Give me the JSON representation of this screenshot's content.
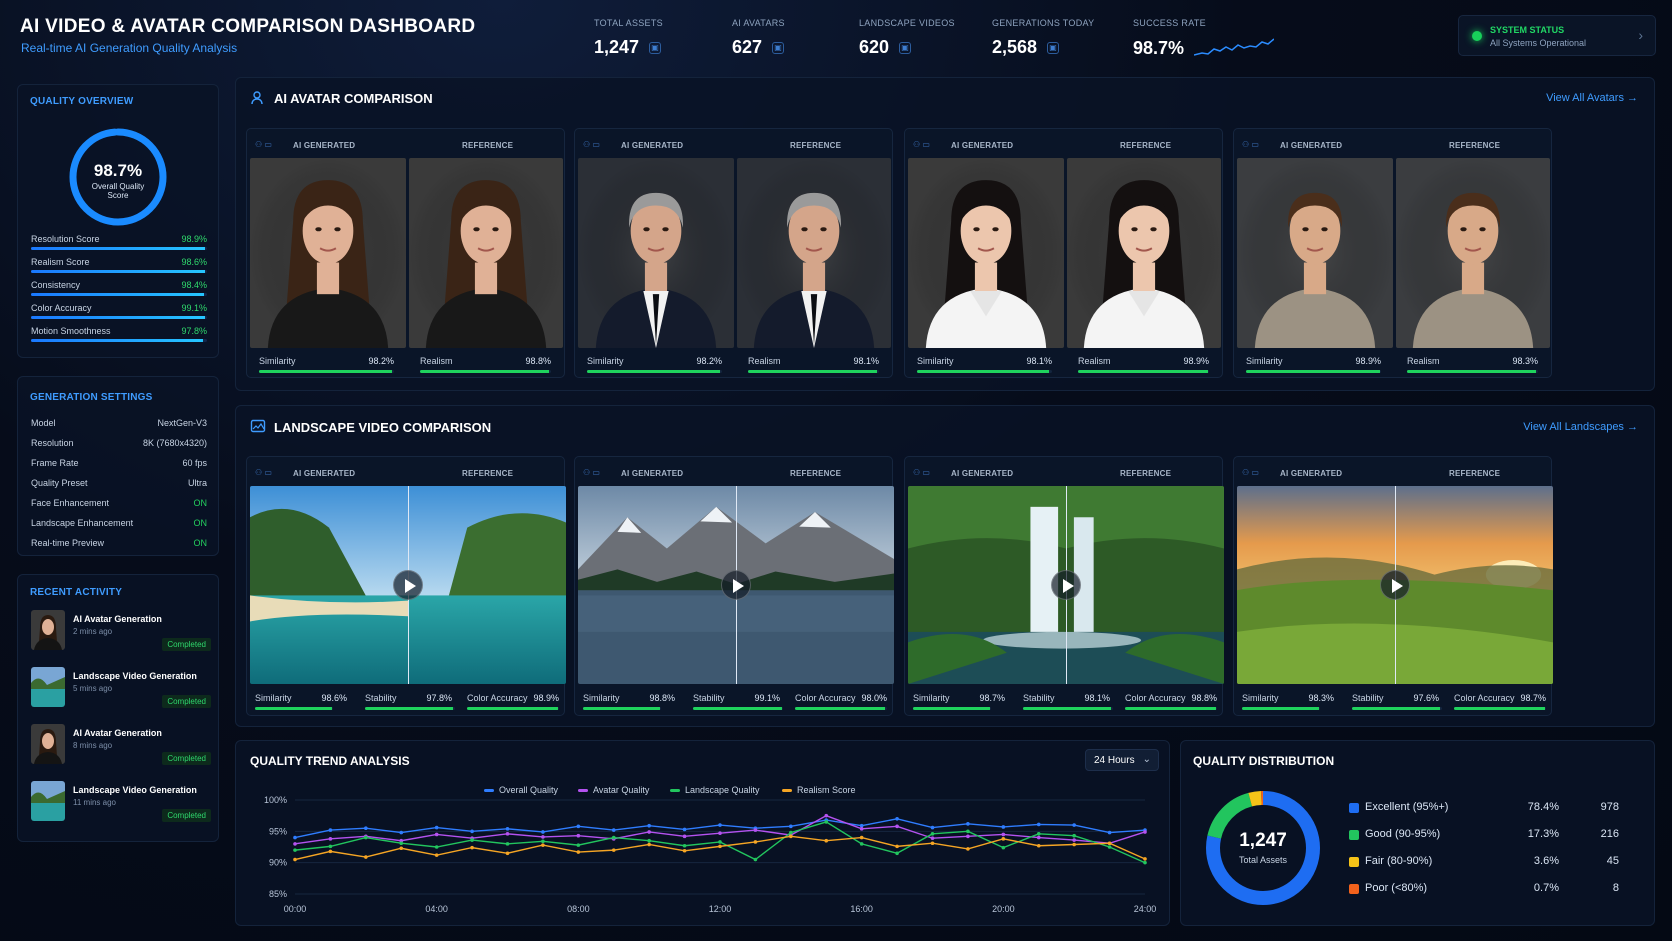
{
  "header": {
    "title": "AI VIDEO & AVATAR COMPARISON DASHBOARD",
    "subtitle": "Real-time AI Generation Quality Analysis"
  },
  "kpis": [
    {
      "label": "TOTAL ASSETS",
      "value": "1,247"
    },
    {
      "label": "AI AVATARS",
      "value": "627"
    },
    {
      "label": "LANDSCAPE VIDEOS",
      "value": "620"
    },
    {
      "label": "GENERATIONS TODAY",
      "value": "2,568"
    },
    {
      "label": "SUCCESS RATE",
      "value": "98.7%"
    }
  ],
  "status": {
    "title": "SYSTEM STATUS",
    "text": "All Systems Operational",
    "color": "#18d05a"
  },
  "quality": {
    "title": "QUALITY OVERVIEW",
    "score": "98.7%",
    "score_label": "Overall Quality Score",
    "score_fraction": 0.987,
    "metrics": [
      {
        "label": "Resolution Score",
        "value": "98.9%",
        "fraction": 0.989
      },
      {
        "label": "Realism Score",
        "value": "98.6%",
        "fraction": 0.986
      },
      {
        "label": "Consistency",
        "value": "98.4%",
        "fraction": 0.984
      },
      {
        "label": "Color Accuracy",
        "value": "99.1%",
        "fraction": 0.991
      },
      {
        "label": "Motion Smoothness",
        "value": "97.8%",
        "fraction": 0.978
      }
    ]
  },
  "settings": {
    "title": "GENERATION SETTINGS",
    "rows": [
      {
        "label": "Model",
        "value": "NextGen-V3"
      },
      {
        "label": "Resolution",
        "value": "8K (7680x4320)"
      },
      {
        "label": "Frame Rate",
        "value": "60 fps"
      },
      {
        "label": "Quality Preset",
        "value": "Ultra"
      },
      {
        "label": "Face Enhancement",
        "value": "ON"
      },
      {
        "label": "Landscape Enhancement",
        "value": "ON"
      },
      {
        "label": "Real-time Preview",
        "value": "ON"
      }
    ]
  },
  "activity": {
    "title": "RECENT ACTIVITY",
    "items": [
      {
        "title": "AI Avatar Generation",
        "time": "2 mins ago",
        "status": "Completed"
      },
      {
        "title": "Landscape Video Generation",
        "time": "5 mins ago",
        "status": "Completed"
      },
      {
        "title": "AI Avatar Generation",
        "time": "8 mins ago",
        "status": "Completed"
      },
      {
        "title": "Landscape Video Generation",
        "time": "11 mins ago",
        "status": "Completed"
      }
    ]
  },
  "avatars": {
    "title": "AI AVATAR COMPARISON",
    "view_all": "View All Avatars",
    "gen_label": "AI GENERATED",
    "ref_label": "REFERENCE",
    "cards": [
      {
        "similarity": "98.2%",
        "realism": "98.8%",
        "sim_f": 0.982,
        "real_f": 0.988
      },
      {
        "similarity": "98.2%",
        "realism": "98.1%",
        "sim_f": 0.982,
        "real_f": 0.981
      },
      {
        "similarity": "98.1%",
        "realism": "98.9%",
        "sim_f": 0.981,
        "real_f": 0.989
      },
      {
        "similarity": "98.9%",
        "realism": "98.3%",
        "sim_f": 0.989,
        "real_f": 0.983
      }
    ],
    "sim_label": "Similarity",
    "real_label": "Realism"
  },
  "landscapes": {
    "title": "LANDSCAPE VIDEO COMPARISON",
    "view_all": "View All Landscapes",
    "gen_label": "AI GENERATED",
    "ref_label": "REFERENCE",
    "sim_label": "Similarity",
    "stab_label": "Stability",
    "col_label": "Color Accuracy",
    "cards": [
      {
        "similarity": "98.6%",
        "stability": "97.8%",
        "color": "98.9%"
      },
      {
        "similarity": "98.8%",
        "stability": "99.1%",
        "color": "98.0%"
      },
      {
        "similarity": "98.7%",
        "stability": "98.1%",
        "color": "98.8%"
      },
      {
        "similarity": "98.3%",
        "stability": "97.6%",
        "color": "98.7%"
      }
    ]
  },
  "trend": {
    "title": "QUALITY TREND ANALYSIS",
    "range": "24 Hours"
  },
  "chart_data": {
    "type": "line",
    "x": [
      "00:00",
      "01:00",
      "02:00",
      "03:00",
      "04:00",
      "05:00",
      "06:00",
      "07:00",
      "08:00",
      "09:00",
      "10:00",
      "11:00",
      "12:00",
      "13:00",
      "14:00",
      "15:00",
      "16:00",
      "17:00",
      "18:00",
      "19:00",
      "20:00",
      "21:00",
      "22:00",
      "23:00",
      "24:00"
    ],
    "xticks": [
      "00:00",
      "04:00",
      "08:00",
      "12:00",
      "16:00",
      "20:00",
      "24:00"
    ],
    "yticks": [
      "100%",
      "95%",
      "90%",
      "85%"
    ],
    "ylim": [
      85,
      100
    ],
    "series": [
      {
        "name": "Overall Quality",
        "color": "#2f7dff",
        "values": [
          94.0,
          95.2,
          95.5,
          94.8,
          95.6,
          95.0,
          95.4,
          94.9,
          95.8,
          95.2,
          95.9,
          95.3,
          96.0,
          95.5,
          95.8,
          96.8,
          95.9,
          97.0,
          95.6,
          96.2,
          95.7,
          96.1,
          96.0,
          94.8,
          95.2
        ]
      },
      {
        "name": "Avatar Quality",
        "color": "#b452f0",
        "values": [
          93.0,
          93.8,
          94.2,
          93.5,
          94.5,
          93.9,
          94.6,
          94.1,
          94.3,
          93.8,
          94.9,
          94.2,
          94.7,
          95.2,
          94.4,
          97.5,
          95.4,
          95.8,
          93.9,
          94.2,
          94.5,
          94.0,
          93.6,
          93.1,
          94.9
        ]
      },
      {
        "name": "Landscape Quality",
        "color": "#22c55e",
        "values": [
          92.0,
          92.6,
          94.0,
          93.1,
          92.5,
          93.6,
          93.0,
          93.4,
          92.8,
          94.0,
          93.5,
          92.7,
          93.3,
          90.5,
          94.8,
          96.5,
          93.0,
          91.5,
          94.6,
          95.0,
          92.4,
          94.6,
          94.3,
          92.5,
          90.0
        ]
      },
      {
        "name": "Realism Score",
        "color": "#f5a524",
        "values": [
          90.5,
          91.8,
          90.9,
          92.3,
          91.2,
          92.4,
          91.5,
          92.8,
          91.7,
          92.0,
          92.9,
          91.9,
          92.6,
          93.3,
          94.2,
          93.5,
          94.0,
          92.6,
          93.1,
          92.2,
          93.8,
          92.7,
          92.9,
          93.1,
          90.6
        ]
      }
    ]
  },
  "distribution": {
    "title": "QUALITY DISTRIBUTION",
    "total": "1,247",
    "total_label": "Total Assets",
    "rows": [
      {
        "label": "Excellent (95%+)",
        "pct": "78.4%",
        "count": "978",
        "color": "#1e6df2",
        "fraction": 0.784
      },
      {
        "label": "Good (90-95%)",
        "pct": "17.3%",
        "count": "216",
        "color": "#22c55e",
        "fraction": 0.173
      },
      {
        "label": "Fair (80-90%)",
        "pct": "3.6%",
        "count": "45",
        "color": "#f5c318",
        "fraction": 0.036
      },
      {
        "label": "Poor (<80%)",
        "pct": "0.7%",
        "count": "8",
        "color": "#f2621c",
        "fraction": 0.007
      }
    ]
  }
}
